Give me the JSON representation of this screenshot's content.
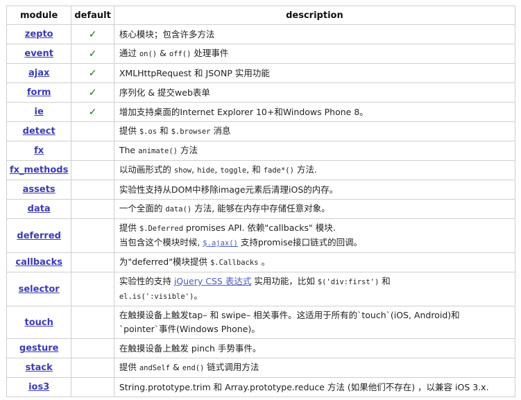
{
  "header": {
    "module": "module",
    "default": "default",
    "description": "description"
  },
  "check": "✓",
  "rows": [
    {
      "module": "zepto",
      "default": true,
      "desc": [
        {
          "t": "text",
          "v": "核心模块；包含许多方法"
        }
      ]
    },
    {
      "module": "event",
      "default": true,
      "desc": [
        {
          "t": "text",
          "v": "通过 "
        },
        {
          "t": "code",
          "v": "on()"
        },
        {
          "t": "text",
          "v": " & "
        },
        {
          "t": "code",
          "v": "off()"
        },
        {
          "t": "text",
          "v": " 处理事件"
        }
      ]
    },
    {
      "module": "ajax",
      "default": true,
      "desc": [
        {
          "t": "text",
          "v": "XMLHttpRequest 和 JSONP 实用功能"
        }
      ]
    },
    {
      "module": "form",
      "default": true,
      "desc": [
        {
          "t": "text",
          "v": "序列化 & 提交web表单"
        }
      ]
    },
    {
      "module": "ie",
      "default": true,
      "desc": [
        {
          "t": "text",
          "v": "增加支持桌面的Internet Explorer 10+和Windows Phone 8。"
        }
      ]
    },
    {
      "module": "detect",
      "default": false,
      "desc": [
        {
          "t": "text",
          "v": "提供 "
        },
        {
          "t": "code",
          "v": "$.os"
        },
        {
          "t": "text",
          "v": " 和 "
        },
        {
          "t": "code",
          "v": "$.browser"
        },
        {
          "t": "text",
          "v": " 消息"
        }
      ]
    },
    {
      "module": "fx",
      "default": false,
      "desc": [
        {
          "t": "text",
          "v": "The "
        },
        {
          "t": "code",
          "v": "animate()"
        },
        {
          "t": "text",
          "v": " 方法"
        }
      ]
    },
    {
      "module": "fx_methods",
      "default": false,
      "desc": [
        {
          "t": "text",
          "v": "以动画形式的 "
        },
        {
          "t": "code",
          "v": "show"
        },
        {
          "t": "text",
          "v": ", "
        },
        {
          "t": "code",
          "v": "hide"
        },
        {
          "t": "text",
          "v": ", "
        },
        {
          "t": "code",
          "v": "toggle"
        },
        {
          "t": "text",
          "v": ", 和 "
        },
        {
          "t": "code",
          "v": "fade*()"
        },
        {
          "t": "text",
          "v": " 方法."
        }
      ]
    },
    {
      "module": "assets",
      "default": false,
      "desc": [
        {
          "t": "text",
          "v": "实验性支持从DOM中移除image元素后清理iOS的内存。"
        }
      ]
    },
    {
      "module": "data",
      "default": false,
      "desc": [
        {
          "t": "text",
          "v": "一个全面的 "
        },
        {
          "t": "code",
          "v": "data()"
        },
        {
          "t": "text",
          "v": " 方法, 能够在内存中存储任意对象。"
        }
      ]
    },
    {
      "module": "deferred",
      "default": false,
      "tall": true,
      "desc": [
        {
          "t": "text",
          "v": "提供 "
        },
        {
          "t": "code",
          "v": "$.Deferred"
        },
        {
          "t": "text",
          "v": " promises API. 依赖\"callbacks\" 模块."
        },
        {
          "t": "br"
        },
        {
          "t": "text",
          "v": "当包含这个模块时候, "
        },
        {
          "t": "linkcode",
          "v": "$.ajax()"
        },
        {
          "t": "text",
          "v": " 支持promise接口链式的回调。"
        }
      ]
    },
    {
      "module": "callbacks",
      "default": false,
      "desc": [
        {
          "t": "text",
          "v": "为\"deferred\"模块提供 "
        },
        {
          "t": "code",
          "v": "$.Callbacks"
        },
        {
          "t": "text",
          "v": " 。"
        }
      ]
    },
    {
      "module": "selector",
      "default": false,
      "tall": true,
      "desc": [
        {
          "t": "text",
          "v": "实验性的支持 "
        },
        {
          "t": "link",
          "v": "jQuery CSS 表达式"
        },
        {
          "t": "text",
          "v": " 实用功能，比如 "
        },
        {
          "t": "code",
          "v": "$('div:first')"
        },
        {
          "t": "text",
          "v": " 和"
        },
        {
          "t": "br"
        },
        {
          "t": "code",
          "v": "el.is(':visible')"
        },
        {
          "t": "text",
          "v": "。"
        }
      ]
    },
    {
      "module": "touch",
      "default": false,
      "tall": true,
      "desc": [
        {
          "t": "text",
          "v": "在触摸设备上触发tap– 和 swipe– 相关事件。这适用于所有的`touch`(iOS, Android)和"
        },
        {
          "t": "br"
        },
        {
          "t": "text",
          "v": "`pointer`事件(Windows Phone)。"
        }
      ]
    },
    {
      "module": "gesture",
      "default": false,
      "desc": [
        {
          "t": "text",
          "v": "在触摸设备上触发 pinch 手势事件。"
        }
      ]
    },
    {
      "module": "stack",
      "default": false,
      "desc": [
        {
          "t": "text",
          "v": "提供 "
        },
        {
          "t": "code",
          "v": "andSelf"
        },
        {
          "t": "text",
          "v": " & "
        },
        {
          "t": "code",
          "v": "end()"
        },
        {
          "t": "text",
          "v": " 链式调用方法"
        }
      ]
    },
    {
      "module": "ios3",
      "default": false,
      "desc": [
        {
          "t": "text",
          "v": "String.prototype.trim 和 Array.prototype.reduce 方法 (如果他们不存在) ，以兼容 iOS 3.x."
        }
      ]
    }
  ]
}
